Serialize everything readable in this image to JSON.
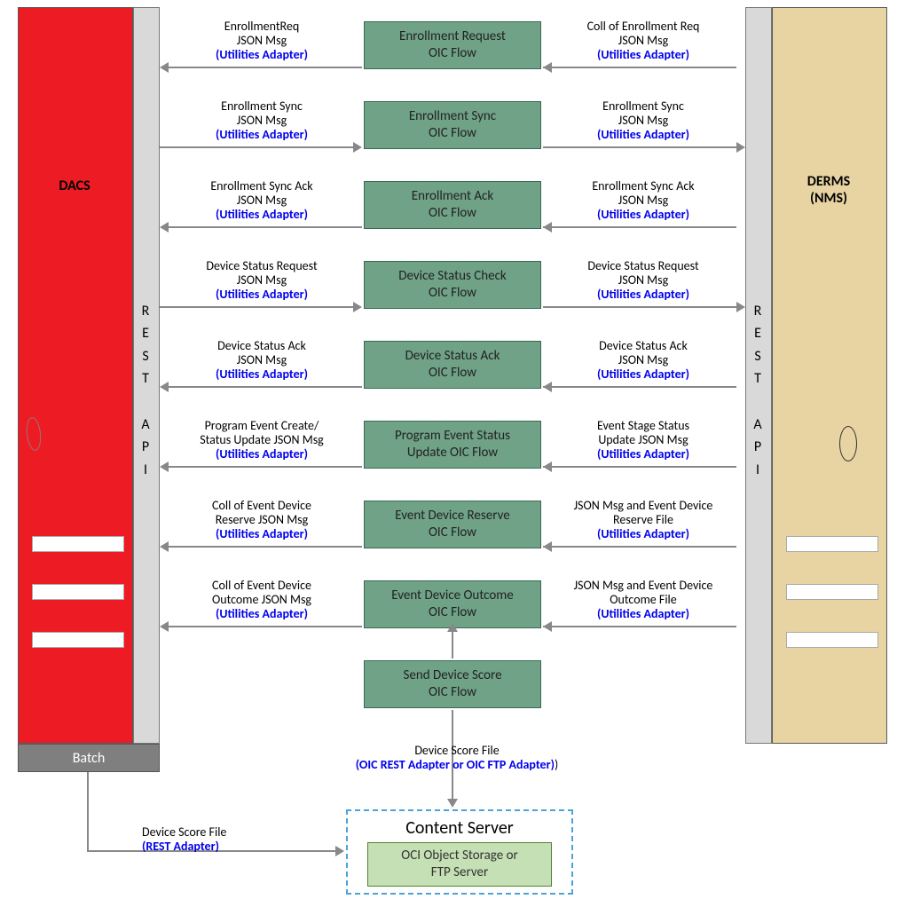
{
  "left_block": {
    "title": "DACS",
    "rest_api": "REST API",
    "batch": "Batch"
  },
  "right_block": {
    "title": "DERMS (NMS)",
    "rest_api": "REST API"
  },
  "content_server": {
    "title": "Content Server",
    "inner": "OCI Object Storage or FTP Server"
  },
  "bottom_arrow": {
    "top_line": "Device Score File",
    "adapter": "(OIC REST Adapter  or OIC  FTP Adapter)"
  },
  "batch_msg": {
    "line1": "Device Score File",
    "adapter": "(REST Adapter)"
  },
  "rows": [
    {
      "oic": "Enrollment Request OIC Flow",
      "left": {
        "l1": "EnrollmentReq",
        "l2": "JSON Msg",
        "ua": "(Utilities Adapter)"
      },
      "right": {
        "l1": "Coll of Enrollment Req",
        "l2": "JSON Msg",
        "ua": "(Utilities Adapter)"
      },
      "ldir": "left",
      "rdir": "left"
    },
    {
      "oic": "Enrollment Sync OIC Flow",
      "left": {
        "l1": "Enrollment Sync",
        "l2": "JSON Msg",
        "ua": "(Utilities Adapter)"
      },
      "right": {
        "l1": "Enrollment Sync",
        "l2": "JSON Msg",
        "ua": "(Utilities Adapter)"
      },
      "ldir": "right",
      "rdir": "right"
    },
    {
      "oic": "Enrollment Ack OIC Flow",
      "left": {
        "l1": "Enrollment Sync Ack",
        "l2": "JSON Msg",
        "ua": "(Utilities Adapter)"
      },
      "right": {
        "l1": "Enrollment Sync Ack",
        "l2": "JSON Msg",
        "ua": "(Utilities Adapter)"
      },
      "ldir": "left",
      "rdir": "left"
    },
    {
      "oic": "Device Status Check OIC Flow",
      "left": {
        "l1": "Device Status Request",
        "l2": "JSON Msg",
        "ua": "(Utilities Adapter)"
      },
      "right": {
        "l1": "Device Status Request",
        "l2": "JSON Msg",
        "ua": "(Utilities Adapter)"
      },
      "ldir": "right",
      "rdir": "right"
    },
    {
      "oic": "Device Status Ack OIC Flow",
      "left": {
        "l1": "Device Status Ack",
        "l2": "JSON Msg",
        "ua": "(Utilities Adapter)"
      },
      "right": {
        "l1": "Device Status Ack",
        "l2": "JSON Msg",
        "ua": "(Utilities Adapter)"
      },
      "ldir": "left",
      "rdir": "left"
    },
    {
      "oic": "Program Event Status Update OIC Flow",
      "left": {
        "l1": "Program Event Create/",
        "l2": "Status Update JSON Msg",
        "ua": "(Utilities Adapter)"
      },
      "right": {
        "l1": "Event Stage Status",
        "l2": "Update JSON Msg",
        "ua": "(Utilities Adapter)"
      },
      "ldir": "left",
      "rdir": "left"
    },
    {
      "oic": "Event Device Reserve OIC Flow",
      "left": {
        "l1": "Coll of Event Device",
        "l2": "Reserve JSON Msg",
        "ua": "(Utilities Adapter)"
      },
      "right": {
        "l1": "JSON Msg and Event Device",
        "l2": "Reserve File",
        "ua": "(Utilities Adapter)"
      },
      "ldir": "left",
      "rdir": "left"
    },
    {
      "oic": "Event Device Outcome OIC Flow",
      "left": {
        "l1": "Coll of Event Device",
        "l2": "Outcome JSON Msg",
        "ua": "(Utilities Adapter)"
      },
      "right": {
        "l1": "JSON Msg and Event Device",
        "l2": "Outcome File",
        "ua": "(Utilities Adapter)"
      },
      "ldir": "left",
      "rdir": "left"
    },
    {
      "oic": "Send Device Score OIC Flow",
      "left": null,
      "right": null
    }
  ]
}
